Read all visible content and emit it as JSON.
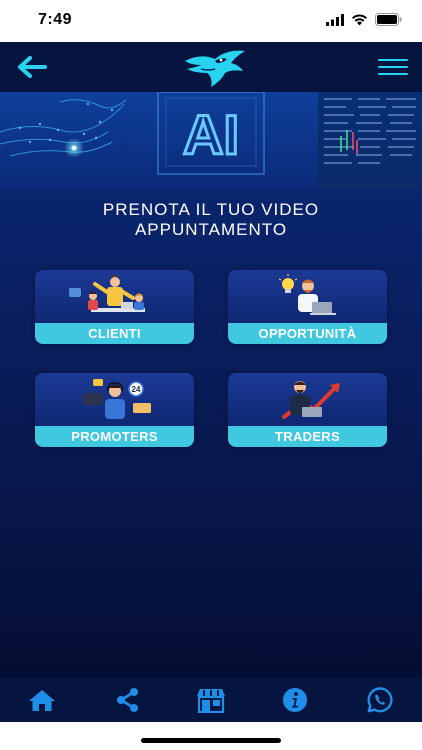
{
  "status_bar": {
    "time": "7:49"
  },
  "navbar": {
    "back_icon": "arrow-left-icon",
    "logo": "eagle-logo",
    "menu_icon": "hamburger-menu-icon"
  },
  "hero": {
    "banner_text": "AI"
  },
  "headline": {
    "line1": "PRENOTA IL TUO VIDEO",
    "line2": "APPUNTAMENTO"
  },
  "tiles": [
    {
      "label": "CLIENTI"
    },
    {
      "label": "OPPORTUNITÀ"
    },
    {
      "label": "PROMOTERS"
    },
    {
      "label": "TRADERS"
    }
  ],
  "promoters_badge": "24",
  "tabbar": {
    "items": [
      "home-icon",
      "share-icon",
      "store-icon",
      "info-icon",
      "whatsapp-icon"
    ]
  },
  "colors": {
    "accent": "#27d3ee",
    "navbar_bg": "#06153f",
    "tile_label_bg": "#40c8e0",
    "tab_icon": "#1e8fe8"
  }
}
